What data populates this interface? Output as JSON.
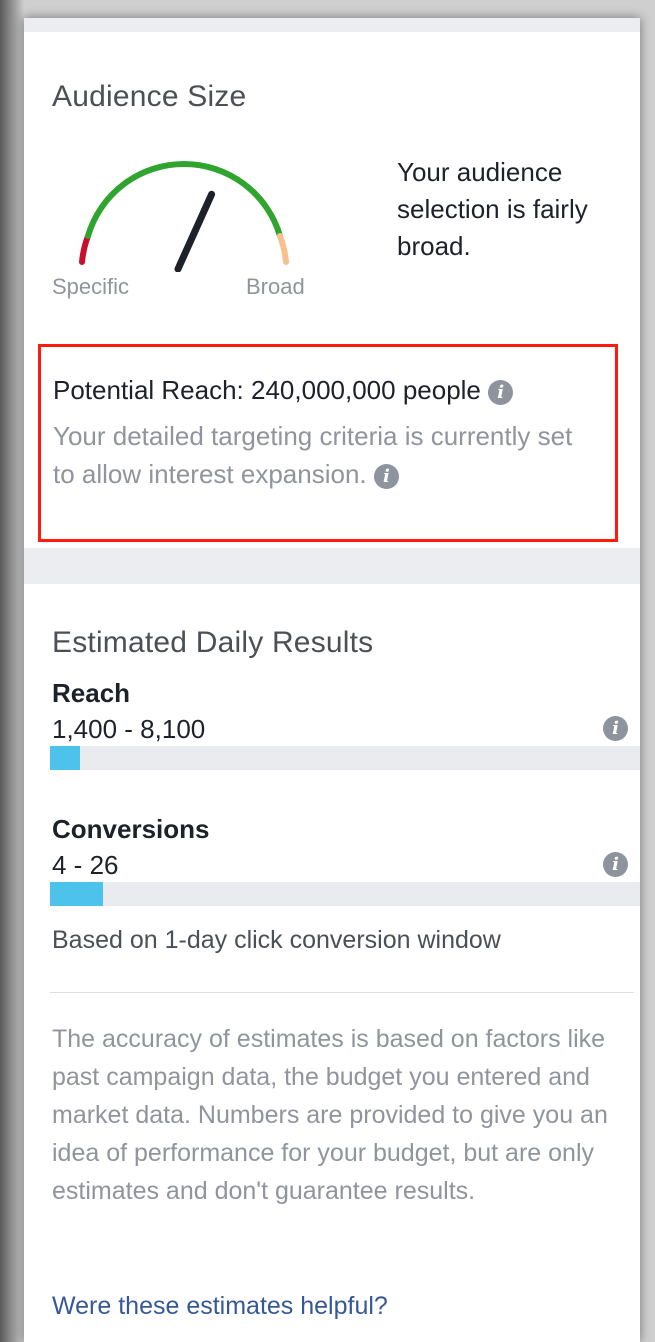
{
  "audience_size": {
    "title": "Audience Size",
    "gauge": {
      "left_label": "Specific",
      "right_label": "Broad",
      "needle_level": 0.62,
      "colors": {
        "specific": "#c8102e",
        "middle": "#2fa42f",
        "broad": "#f8c08c",
        "needle": "#1d2129"
      }
    },
    "description": "Your audience selection is fairly broad.",
    "potential_reach": "Potential Reach: 240,000,000 people",
    "reach_note": "Your detailed targeting criteria is currently set to allow interest expansion.",
    "highlight_color": "#ff1c0e",
    "info_icon": "info-icon"
  },
  "estimated_daily_results": {
    "title": "Estimated Daily Results",
    "reach": {
      "label": "Reach",
      "range": "1,400 - 8,100",
      "bar_level": 0.05
    },
    "conversions": {
      "label": "Conversions",
      "range": "4 - 26",
      "bar_level": 0.09
    },
    "basis": "Based on 1-day click conversion window",
    "bar_color": "#4dc3eb",
    "disclaimer": "The accuracy of estimates is based on factors like past campaign data, the budget you entered and market data. Numbers are provided to give you an idea of performance for your budget, but are only estimates and don't guarantee results.",
    "feedback_link": "Were these estimates helpful?"
  }
}
